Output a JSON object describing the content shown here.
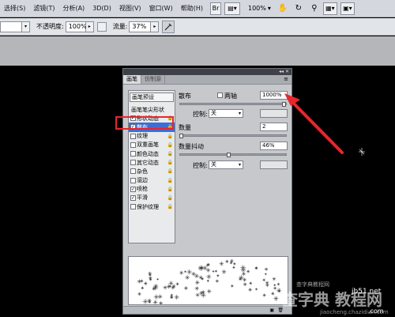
{
  "menubar": {
    "items": [
      {
        "label": "选择(S)",
        "name": "menu-select"
      },
      {
        "label": "滤镜(T)",
        "name": "menu-filter"
      },
      {
        "label": "分析(A)",
        "name": "menu-analysis"
      },
      {
        "label": "3D(D)",
        "name": "menu-3d"
      },
      {
        "label": "视图(V)",
        "name": "menu-view"
      },
      {
        "label": "窗口(W)",
        "name": "menu-window"
      },
      {
        "label": "帮助(H)",
        "name": "menu-help"
      }
    ],
    "zoom": "100%",
    "icons": [
      "bridge-icon",
      "layout-icon",
      "hand-tool-icon",
      "rotate-view-icon",
      "zoom-tool-icon",
      "arrange-icon",
      "workspace-icon"
    ]
  },
  "optionsbar": {
    "opacity_label": "不透明度:",
    "opacity_value": "100%",
    "flow_label": "流量:",
    "flow_value": "37%"
  },
  "brush_panel": {
    "tabs": [
      {
        "label": "画笔",
        "active": true
      },
      {
        "label": "仿制源",
        "active": false
      }
    ],
    "preset_button": "画笔预设",
    "tip_shape": "画笔笔尖形状",
    "options": [
      {
        "label": "形状动态",
        "checked": true,
        "lock": true
      },
      {
        "label": "散布",
        "checked": true,
        "lock": true,
        "selected": true
      },
      {
        "label": "纹理",
        "checked": false,
        "lock": true
      },
      {
        "label": "双重画笔",
        "checked": false,
        "lock": true
      },
      {
        "label": "颜色动态",
        "checked": false,
        "lock": true
      },
      {
        "label": "其它动态",
        "checked": false,
        "lock": true
      },
      {
        "label": "杂色",
        "checked": false,
        "lock": true
      },
      {
        "label": "湿边",
        "checked": false,
        "lock": true
      },
      {
        "label": "喷枪",
        "checked": true,
        "lock": true
      },
      {
        "label": "平滑",
        "checked": true,
        "lock": true
      },
      {
        "label": "保护纹理",
        "checked": false,
        "lock": true
      }
    ],
    "scatter": {
      "label": "散布",
      "both_axes_label": "两轴",
      "value": "1000%",
      "slider_fraction": 1.0,
      "control_label": "控制:",
      "control_value": "关"
    },
    "count": {
      "label": "数量",
      "value": "2"
    },
    "count_jitter": {
      "label": "数量抖动",
      "value": "46%",
      "slider_fraction": 0.46,
      "control_label": "控制:",
      "control_value": "关"
    }
  },
  "watermark": {
    "site": "查字典教程网",
    "chars": "查字典 教程网",
    "url": "jiaocheng.chazidian.com",
    "jb": "jb51.net",
    "com": ".com"
  },
  "colors": {
    "highlight": "#3b6fd6",
    "annotation_red": "#e8262e",
    "canvas": "#000000"
  }
}
